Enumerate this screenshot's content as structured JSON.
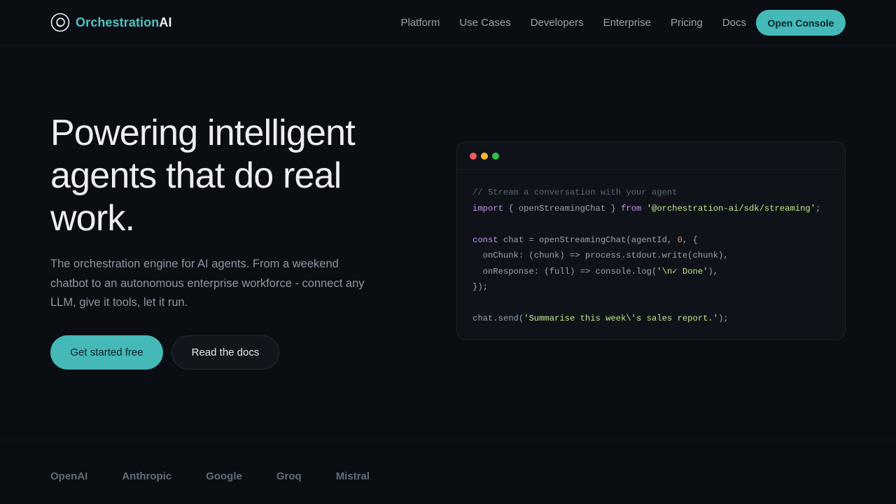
{
  "brand": {
    "name_part1": "Orchestration",
    "name_part2": "AI"
  },
  "nav": {
    "links": [
      "Platform",
      "Use Cases",
      "Developers",
      "Enterprise",
      "Pricing",
      "Docs"
    ],
    "cta": "Open Console"
  },
  "hero": {
    "title": "Powering intelligent agents that do real work.",
    "subtitle": "The orchestration engine for AI agents. From a weekend chatbot to an autonomous enterprise workforce - connect any LLM, give it tools, let it run.",
    "primary_cta": "Get started free",
    "secondary_cta": "Read the docs"
  },
  "code": {
    "lines": [
      [
        {
          "t": "// Stream a conversation with your agent",
          "c": "comment"
        }
      ],
      [
        {
          "t": "import",
          "c": "kw"
        },
        {
          "t": " { openStreamingChat } ",
          "c": "plain"
        },
        {
          "t": "from",
          "c": "kw"
        },
        {
          "t": " ",
          "c": "plain"
        },
        {
          "t": "'@orchestration-ai/sdk/streaming'",
          "c": "str"
        },
        {
          "t": ";",
          "c": "plain"
        }
      ],
      [],
      [
        {
          "t": "const",
          "c": "kw"
        },
        {
          "t": " chat = openStreamingChat(agentId, ",
          "c": "plain"
        },
        {
          "t": "0",
          "c": "num"
        },
        {
          "t": ", {",
          "c": "plain"
        }
      ],
      [
        {
          "t": "  onChunk: (chunk) => process.stdout.write(chunk),",
          "c": "plain"
        }
      ],
      [
        {
          "t": "  onResponse: (full) => console.log(",
          "c": "plain"
        },
        {
          "t": "'\\n✓ Done'",
          "c": "str"
        },
        {
          "t": "),",
          "c": "plain"
        }
      ],
      [
        {
          "t": "});",
          "c": "plain"
        }
      ],
      [],
      [
        {
          "t": "chat.send(",
          "c": "plain"
        },
        {
          "t": "'Summarise this week\\'s sales report.'",
          "c": "str"
        },
        {
          "t": ");",
          "c": "plain"
        }
      ]
    ]
  },
  "partners": [
    "OpenAI",
    "Anthropic",
    "Google",
    "Groq",
    "Mistral"
  ],
  "colors": {
    "accent": "#45b8b8",
    "background": "#0a0d12"
  }
}
